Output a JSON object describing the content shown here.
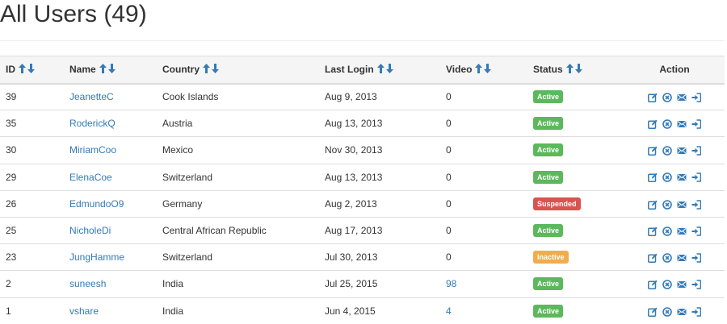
{
  "page": {
    "title": "All Users (49)"
  },
  "colors": {
    "link": "#337ab7",
    "sort_arrow": "#337ab7",
    "action_icon": "#337ab7",
    "status": {
      "Active": "#5cb85c",
      "Suspended": "#d9534f",
      "Inactive": "#f0ad4e"
    }
  },
  "table": {
    "columns": [
      {
        "key": "id",
        "label": "ID",
        "sortable": true
      },
      {
        "key": "name",
        "label": "Name",
        "sortable": true
      },
      {
        "key": "country",
        "label": "Country",
        "sortable": true
      },
      {
        "key": "last_login",
        "label": "Last Login",
        "sortable": true
      },
      {
        "key": "video",
        "label": "Video",
        "sortable": true
      },
      {
        "key": "status",
        "label": "Status",
        "sortable": true
      },
      {
        "key": "action",
        "label": "Action",
        "sortable": false
      }
    ],
    "sort_icons": [
      "sort-ascending-icon",
      "sort-descending-icon"
    ],
    "action_icons": [
      "edit-icon",
      "delete-icon",
      "email-icon",
      "login-as-icon"
    ],
    "rows": [
      {
        "id": "39",
        "name": "JeanetteC",
        "country": "Cook Islands",
        "last_login": "Aug 9, 2013",
        "video": "0",
        "video_link": false,
        "status": "Active"
      },
      {
        "id": "35",
        "name": "RoderickQ",
        "country": "Austria",
        "last_login": "Aug 13, 2013",
        "video": "0",
        "video_link": false,
        "status": "Active"
      },
      {
        "id": "30",
        "name": "MiriamCoo",
        "country": "Mexico",
        "last_login": "Nov 30, 2013",
        "video": "0",
        "video_link": false,
        "status": "Active"
      },
      {
        "id": "29",
        "name": "ElenaCoe",
        "country": "Switzerland",
        "last_login": "Aug 13, 2013",
        "video": "0",
        "video_link": false,
        "status": "Active"
      },
      {
        "id": "26",
        "name": "EdmundoO9",
        "country": "Germany",
        "last_login": "Aug 2, 2013",
        "video": "0",
        "video_link": false,
        "status": "Suspended"
      },
      {
        "id": "25",
        "name": "NicholeDi",
        "country": "Central African Republic",
        "last_login": "Aug 17, 2013",
        "video": "0",
        "video_link": false,
        "status": "Active"
      },
      {
        "id": "23",
        "name": "JungHamme",
        "country": "Switzerland",
        "last_login": "Jul 30, 2013",
        "video": "0",
        "video_link": false,
        "status": "Inactive"
      },
      {
        "id": "2",
        "name": "suneesh",
        "country": "India",
        "last_login": "Jul 25, 2015",
        "video": "98",
        "video_link": true,
        "status": "Active"
      },
      {
        "id": "1",
        "name": "vshare",
        "country": "India",
        "last_login": "Jun 4, 2015",
        "video": "4",
        "video_link": true,
        "status": "Active"
      }
    ]
  }
}
